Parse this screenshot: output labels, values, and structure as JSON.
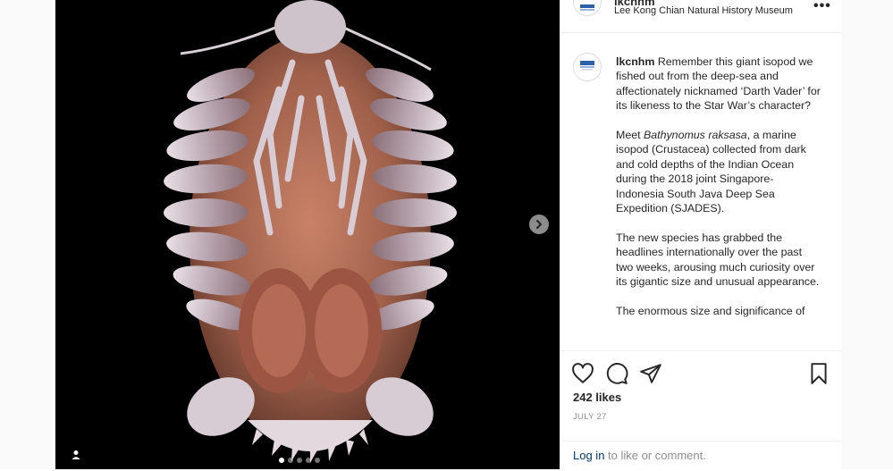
{
  "post": {
    "media_alt": "giant isopod ventral view",
    "carousel": {
      "count": 5,
      "active_index": 0
    }
  },
  "header": {
    "username": "lkcnhm",
    "subtitle": "Lee Kong Chian Natural History Museum",
    "more_glyph": "•••"
  },
  "caption": {
    "username": "lkcnhm",
    "p1_rest": " Remember this giant isopod we fished out from the deep-sea and affectionately nicknamed ‘Darth Vader’ for its likeness to the Star War’s character?",
    "p2_before": "Meet ",
    "p2_italic": "Bathynomus raksasa",
    "p2_after": ", a marine isopod (Crustacea) collected from dark and cold depths of the Indian Ocean during the 2018 joint Singapore-Indonesia South Java Deep Sea Expedition (SJADES).",
    "p3": "The new species has grabbed the headlines internationally over the past two weeks, arousing much curiosity over its gigantic size and unusual appearance.",
    "p4": "The enormous size and significance of"
  },
  "engagement": {
    "likes": "242 likes",
    "date": "JULY 27"
  },
  "comment": {
    "login_link": "Log in",
    "login_rest": " to like or comment."
  },
  "icons": {
    "like": "heart-icon",
    "comment": "comment-icon",
    "share": "paper-plane-icon",
    "save": "bookmark-icon",
    "next": "chevron-right-icon",
    "tag": "user-tag-icon"
  },
  "colors": {
    "link": "#00376b",
    "muted": "#8e8e8e",
    "text": "#262626",
    "border": "#efefef"
  }
}
